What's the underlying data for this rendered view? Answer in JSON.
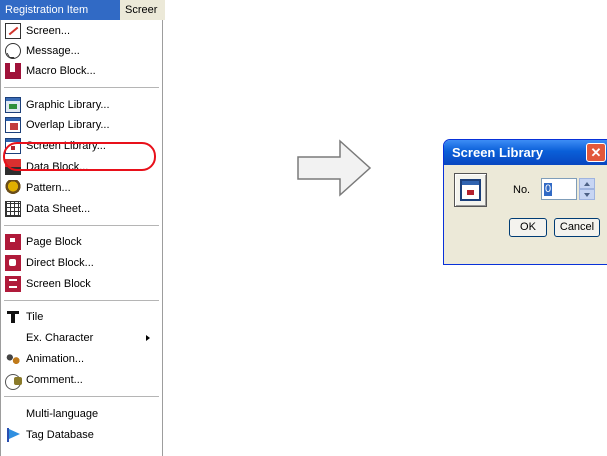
{
  "menubar": {
    "active_label": "Registration Item",
    "next_label": "Screer"
  },
  "menu": {
    "items": [
      {
        "label": "Screen...",
        "icon": "screen-icon"
      },
      {
        "label": "Message...",
        "icon": "message-icon"
      },
      {
        "label": "Macro Block...",
        "icon": "macro-block-icon"
      },
      {
        "label": "Graphic Library...",
        "icon": "graphic-library-icon"
      },
      {
        "label": "Overlap Library...",
        "icon": "overlap-library-icon"
      },
      {
        "label": "Screen Library...",
        "icon": "screen-library-icon"
      },
      {
        "label": "Data Block...",
        "icon": "data-block-icon"
      },
      {
        "label": "Pattern...",
        "icon": "pattern-icon"
      },
      {
        "label": "Data Sheet...",
        "icon": "data-sheet-icon"
      },
      {
        "label": "Page Block",
        "icon": "page-block-icon"
      },
      {
        "label": "Direct Block...",
        "icon": "direct-block-icon"
      },
      {
        "label": "Screen Block",
        "icon": "screen-block-icon"
      },
      {
        "label": "Tile",
        "icon": "tile-icon"
      },
      {
        "label": "Ex. Character",
        "icon": "none",
        "submenu": true
      },
      {
        "label": "Animation...",
        "icon": "animation-icon"
      },
      {
        "label": "Comment...",
        "icon": "comment-icon"
      },
      {
        "label": "Multi-language",
        "icon": "none"
      },
      {
        "label": "Tag Database",
        "icon": "tag-database-icon"
      }
    ],
    "highlighted": "Screen Library...",
    "highlight_color": "#e8101a"
  },
  "dialog": {
    "title": "Screen Library",
    "close_symbol": "✕",
    "no_label": "No.",
    "no_value": "0",
    "ok_label": "OK",
    "cancel_label": "Cancel"
  },
  "colors": {
    "menu_highlight": "#316ac5",
    "title_bar": "#0a5fd8",
    "close_button": "#e2583b"
  }
}
